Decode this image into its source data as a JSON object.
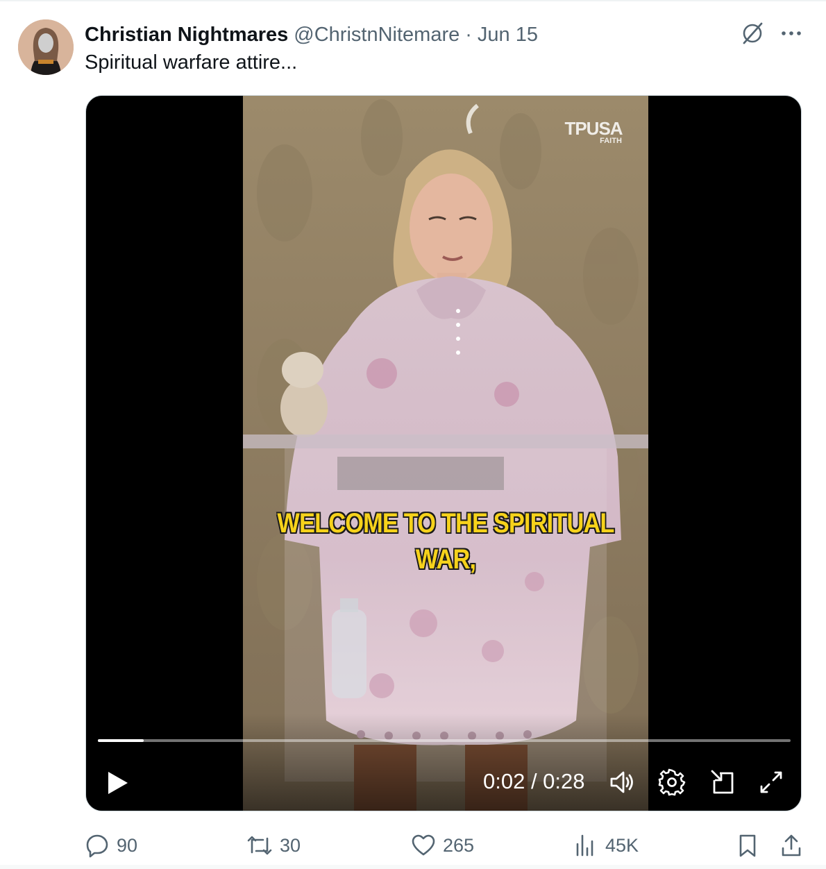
{
  "tweet": {
    "author_name": "Christian Nightmares",
    "author_handle": "@ChristnNitemare",
    "separator": "·",
    "date": "Jun 15",
    "text": "Spiritual warfare attire..."
  },
  "video": {
    "caption_line1": "WELCOME TO THE SPIRITUAL",
    "caption_line2": "WAR,",
    "watermark": "TPUSA",
    "watermark_sub": "FAITH",
    "time_display": "0:02 / 0:28",
    "progress": 0.066,
    "play_icon": "play-icon",
    "volume_icon": "volume-icon",
    "settings_icon": "gear-icon",
    "dock_icon": "dock-icon",
    "fullscreen_icon": "expand-icon"
  },
  "actions": {
    "replies": "90",
    "reposts": "30",
    "likes": "265",
    "views": "45K"
  },
  "colors": {
    "text_primary": "#0f1419",
    "text_secondary": "#536471",
    "caption_yellow": "#f6d21b"
  }
}
